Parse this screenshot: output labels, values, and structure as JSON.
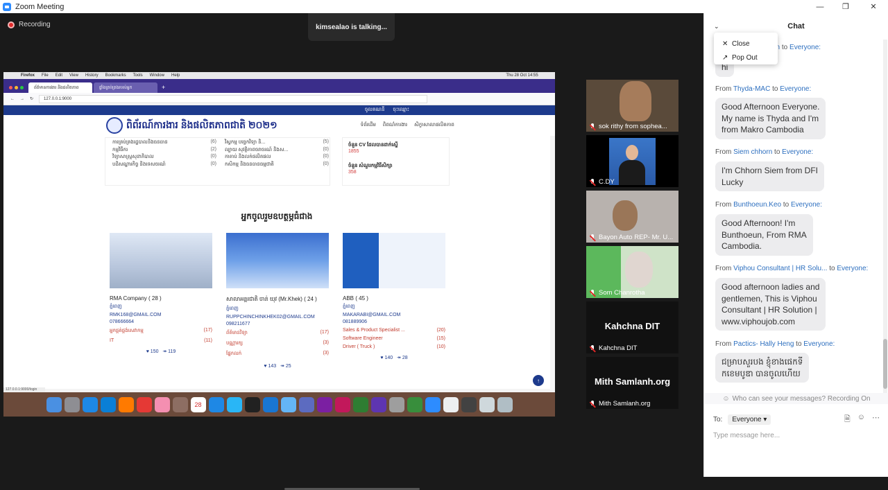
{
  "window": {
    "title": "Zoom Meeting"
  },
  "meeting": {
    "recording_label": "Recording",
    "talking_indicator": "kimsealao is talking..."
  },
  "shared_screen": {
    "mac_menu": [
      "Firefox",
      "File",
      "Edit",
      "View",
      "History",
      "Bookmarks",
      "Tools",
      "Window",
      "Help"
    ],
    "mac_clock": "Thu 28 Oct 14:55",
    "tabs": [
      "ព័ត៌មានការងារ និងផលិតភាព",
      "ផ្ទាំងគ្រប់គ្រងរបស់អ្នក"
    ],
    "url": "127.0.0.1:9000",
    "site_topbar": [
      "ចុះឈ្មោះ",
      "ចូលគណនី"
    ],
    "site_title": "ពិព័រណ៍ការងារ និងផលិតភាពជាតិ ២០២១",
    "site_nav": [
      "ទំព័រដើម",
      "ពិពណ៌ការងារ",
      "សិក្ខាសាលាផលិតភាព"
    ],
    "categories_left": [
      {
        "label": "ការគ្រប់គ្រងរដ្ឋបាលនិងធនធាន",
        "count": "(6)"
      },
      {
        "label": "កម្មវិធីករ",
        "count": "(2)"
      },
      {
        "label": "វិទ្យាសាស្ត្រសុខាភិបាល",
        "count": "(0)"
      },
      {
        "label": "បដិសណ្ឋារកិច្ច និងទេសចរណ៍",
        "count": "(0)"
      }
    ],
    "categories_right": [
      {
        "label": "វិស្វកម្ម បច្ចេកវិទ្យា និ...",
        "count": "(5)"
      },
      {
        "label": "ល្បាយ សុវត្ថិភាពចរាចរណ៍ និងស...",
        "count": "(0)"
      },
      {
        "label": "កាតាប់ និងលក់ផលិតផល",
        "count": "(0)"
      },
      {
        "label": "កសិកម្ម និងធនធានធម្មជាតិ",
        "count": "(0)"
      }
    ],
    "stats": [
      {
        "label": "ចំនួន CV ដែលបានដាក់ស្នើ",
        "value": "1855"
      },
      {
        "label": "ចំនួន សំណួរកម្មវិធីសិក្សា",
        "value": "358"
      }
    ],
    "section_title": "អ្នកចូលរួមឧបត្ថម្ភធំជាង",
    "companies": [
      {
        "name": "RMA Company ( 28 )",
        "location": "ភ្នំពេញ",
        "email": "RMK168@GMAIL.COM",
        "phone": "078666664",
        "tags": [
          {
            "label": "អ្នកផ្គត់ផ្គង់សេវាកម្ម",
            "count": "(17)"
          },
          {
            "label": "IT",
            "count": "(11)"
          }
        ],
        "likes": "150",
        "views": "119"
      },
      {
        "name": "សាលាអន្តរជាតិ ចាន់ យុវ (Mr.Khek) ( 24 )",
        "location": "ភ្នំពេញ",
        "email": "RUPPCHINCHINKHEK02@GMAIL.COM",
        "phone": "098211677",
        "tags": [
          {
            "label": "ព័ត៌មានវិទ្យា",
            "count": "(17)"
          },
          {
            "label": "បណ្ណារក្ស",
            "count": "(3)"
          },
          {
            "label": "ផ្នែកលក់",
            "count": "(3)"
          }
        ],
        "likes": "143",
        "views": "25"
      },
      {
        "name": "ABB ( 45 )",
        "location": "ភ្នំពេញ",
        "email": "MAKARABI@GMAIL.COM",
        "phone": "081889906",
        "tags": [
          {
            "label": "Sales & Product Specialist ...",
            "count": "(20)"
          },
          {
            "label": "Software Engineer",
            "count": "(15)"
          },
          {
            "label": "Driver ( Truck )",
            "count": "(10)"
          }
        ],
        "likes": "140",
        "views": "28"
      }
    ],
    "status_url": "127.0.0.1:9000/login",
    "dock_date": "28"
  },
  "participants": [
    {
      "name": "sok rithy from sophea..."
    },
    {
      "name": "C.DY"
    },
    {
      "name": "Bayon Auto REP- Mr. U..."
    },
    {
      "name": "Som Chanrotha"
    },
    {
      "name": "Kahchna DIT",
      "display": "Kahchna DIT"
    },
    {
      "name": "Mith Samlanh.org",
      "display": "Mith Samlanh.org"
    }
  ],
  "chat": {
    "title": "Chat",
    "menu": {
      "close": "Close",
      "pop_out": "Pop Out"
    },
    "partial_first": {
      "from_tail": "an",
      "to_word": "to",
      "to": "Everyone:",
      "text": "hi"
    },
    "messages": [
      {
        "from_word": "From",
        "from": "Thyda-MAC",
        "to_word": "to",
        "to": "Everyone:",
        "lines": [
          "Good Afternoon Everyone.",
          "My name is Thyda and I'm",
          "from Makro Cambodia"
        ]
      },
      {
        "from_word": "From",
        "from": "Siem chhorn",
        "to_word": "to",
        "to": "Everyone:",
        "lines": [
          "I'm Chhorn Siem from DFI",
          "Lucky"
        ]
      },
      {
        "from_word": "From",
        "from": "Bunthoeun.Keo",
        "to_word": "to",
        "to": "Everyone:",
        "lines": [
          "Good Afternoon! I'm",
          "Bunthoeun, From RMA",
          "Cambodia."
        ]
      },
      {
        "from_word": "From",
        "from": "Viphou Consultant | HR Solu...",
        "to_word": "to",
        "to": "Everyone:",
        "lines": [
          "Good afternoon ladies and",
          "gentlemen, This is Viphou",
          "Consultant | HR Solution |",
          "www.viphoujob.com"
        ]
      },
      {
        "from_word": "From",
        "from": "Pactics- Hally Heng",
        "to_word": "to",
        "to": "Everyone:",
        "lines": [
          "ជម្រាបសួរបង ខ្ញុំខាងផេកទី",
          "កខេមបូឌា បានចូលហើយ"
        ]
      }
    ],
    "visibility_note": "Who can see your messages? Recording On",
    "to_label": "To:",
    "to_value": "Everyone",
    "input_placeholder": "Type message here..."
  },
  "colors": {
    "zoom_blue": "#2d8cff",
    "chat_link": "#2d6fbf",
    "bubble": "#ececee",
    "muted_mic": "#e02828"
  }
}
